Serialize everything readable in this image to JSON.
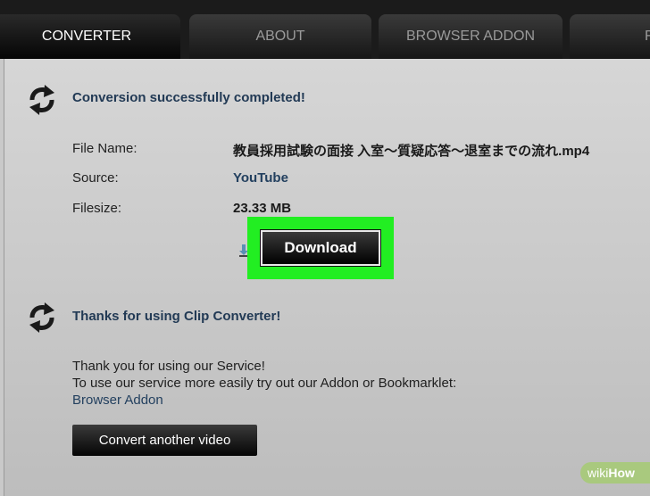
{
  "tabs": [
    {
      "label": "CONVERTER",
      "active": true
    },
    {
      "label": "ABOUT",
      "active": false
    },
    {
      "label": "BROWSER ADDON",
      "active": false
    },
    {
      "label": "F",
      "active": false
    }
  ],
  "result": {
    "heading": "Conversion successfully completed!",
    "file_name_label": "File Name:",
    "file_name": "教員採用試験の面接 入室〜質疑応答〜退室までの流れ.mp4",
    "source_label": "Source:",
    "source": "YouTube",
    "filesize_label": "Filesize:",
    "filesize": "23.33 MB",
    "download_label": "Download"
  },
  "thanks": {
    "heading": "Thanks for using Clip Converter!",
    "line1": "Thank you for using our Service!",
    "line2": "To use our service more easily try out our Addon or Bookmarklet:",
    "addon_link": "Browser Addon",
    "convert_label": "Convert another video"
  },
  "watermark": {
    "wiki": "wiki",
    "how": "How"
  },
  "colors": {
    "highlight": "#22ee22",
    "heading": "#223a55",
    "tabbar": "#1b1b1b"
  },
  "icons": [
    "refresh-arrows-icon",
    "download-arrow-icon"
  ]
}
